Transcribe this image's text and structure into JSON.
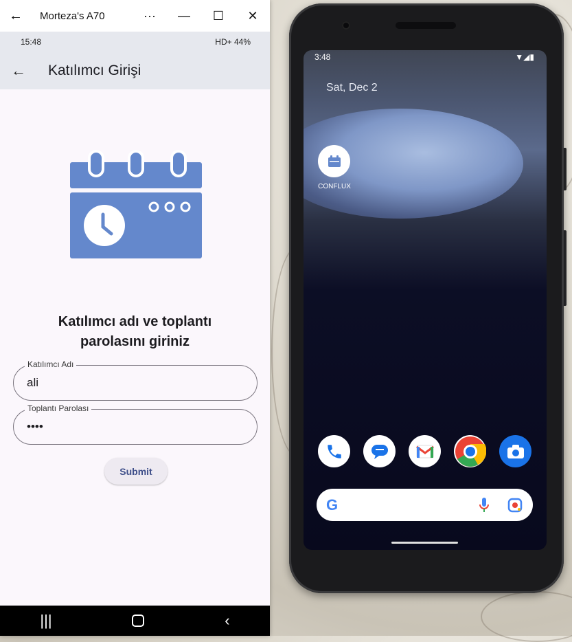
{
  "window": {
    "title": "Morteza's A70",
    "back_icon": "arrow-left-icon",
    "more_label": "···",
    "minimize_label": "—",
    "maximize_label": "☐",
    "close_label": "✕"
  },
  "phone": {
    "status": {
      "time": "15:48",
      "right": "HD+  44%"
    },
    "appbar": {
      "title": "Katılımcı Girişi"
    },
    "heading": "Katılımcı adı ve toplantı parolasını giriniz",
    "fields": [
      {
        "label": "Katılımcı Adı",
        "value": "ali"
      },
      {
        "label": "Toplantı Parolası",
        "value": "••••"
      }
    ],
    "submit_label": "Submit",
    "accent_color": "#6488cc"
  },
  "emulator": {
    "status_time": "3:48",
    "date": "Sat, Dec 2",
    "app_label": "CONFLUX",
    "dock": [
      "phone-icon",
      "messages-icon",
      "gmail-icon",
      "chrome-icon",
      "camera-icon"
    ]
  }
}
